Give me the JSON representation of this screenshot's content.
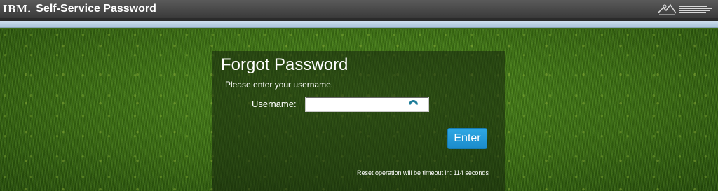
{
  "header": {
    "brand_logo": "IBM.",
    "title": "Self-Service Password",
    "corner_logo_icon": "organization-logo-icon"
  },
  "panel": {
    "title": "Forgot Password",
    "instructions": "Please enter your username.",
    "username_label": "Username:",
    "username_value": "",
    "input_icon": "loading-spinner-icon",
    "enter_label": "Enter",
    "timeout_text": "Reset operation will be timeout in: 114 seconds"
  },
  "colors": {
    "header_bg": "#3a3a3a",
    "button_bg": "#1b8ccb",
    "grass": "#3d6a14"
  }
}
